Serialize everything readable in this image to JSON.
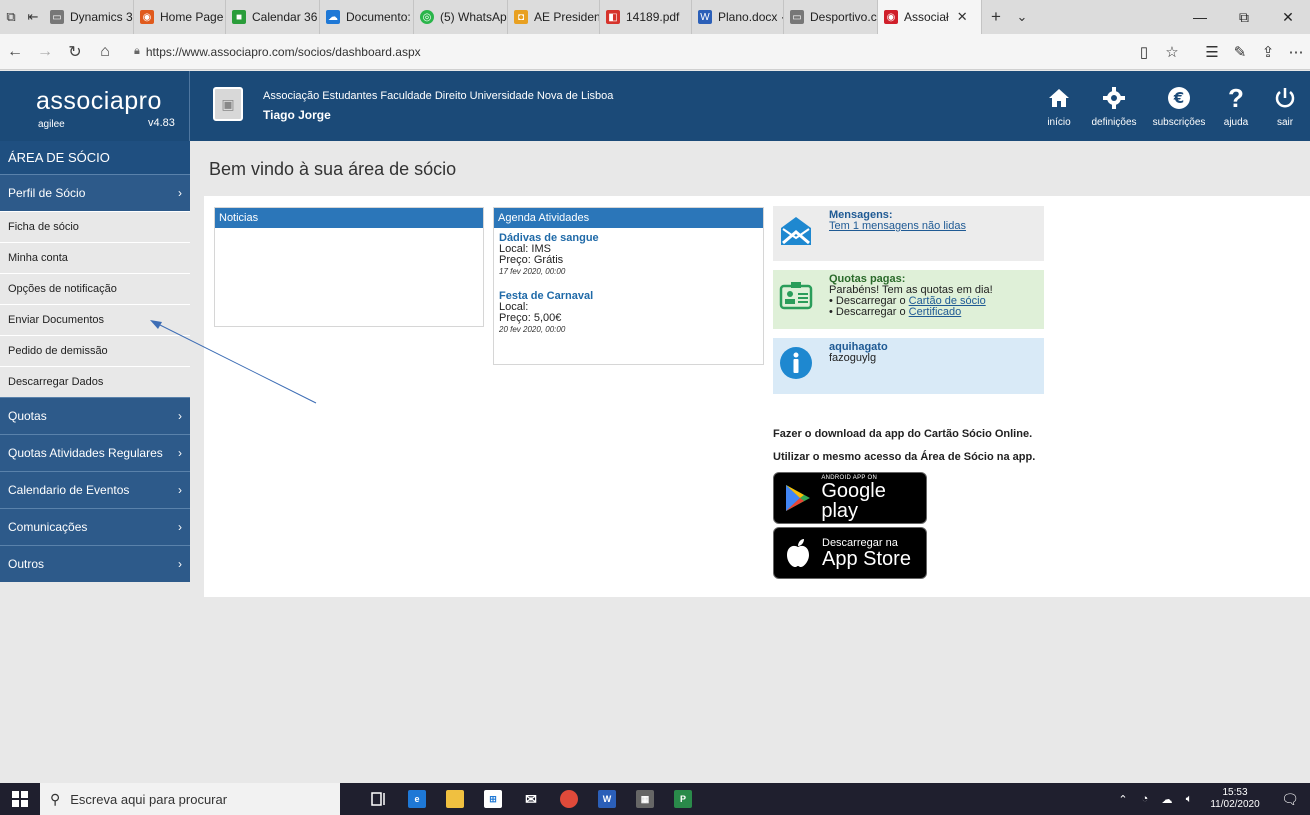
{
  "browser": {
    "tabs": [
      {
        "label": "Dynamics 3(",
        "fav_color": "#555555",
        "fav_glyph": "▭"
      },
      {
        "label": "Home Page",
        "fav_color": "#e05a1c",
        "fav_glyph": "◉"
      },
      {
        "label": "Calendar 36",
        "fav_color": "#2a9d3a",
        "fav_glyph": "■"
      },
      {
        "label": "Documento:",
        "fav_color": "#1e78d6",
        "fav_glyph": "☁"
      },
      {
        "label": "(5) WhatsAp",
        "fav_color": "#2ab54a",
        "fav_glyph": "◎"
      },
      {
        "label": "AE Presiden",
        "fav_color": "#e8a021",
        "fav_glyph": "◘"
      },
      {
        "label": "14189.pdf",
        "fav_color": "#d6332b",
        "fav_glyph": "◧"
      },
      {
        "label": "Plano.docx ·",
        "fav_color": "#2b5fb8",
        "fav_glyph": "W"
      },
      {
        "label": "Desportivo.c",
        "fav_color": "#555555",
        "fav_glyph": "▭"
      },
      {
        "label": "Associał",
        "fav_color": "#d01f2a",
        "fav_glyph": "◉",
        "active": true
      }
    ],
    "url": "https://www.associapro.com/socios/dashboard.aspx"
  },
  "header": {
    "logo": "associapro",
    "logo_sub": "agilee",
    "version": "v4.83",
    "org": "Associação Estudantes Faculdade Direito Universidade Nova de Lisboa",
    "user": "Tiago Jorge",
    "nav": [
      {
        "label": "início",
        "icon": "home-icon",
        "glyph": "⌂"
      },
      {
        "label": "definições",
        "icon": "gear-icon",
        "glyph": "⚙"
      },
      {
        "label": "subscrições",
        "icon": "euro-icon",
        "glyph": "€"
      },
      {
        "label": "ajuda",
        "icon": "help-icon",
        "glyph": "?"
      },
      {
        "label": "sair",
        "icon": "power-icon",
        "glyph": "⏻"
      }
    ]
  },
  "sidebar": {
    "title": "ÁREA DE SÓCIO",
    "profile": "Perfil de Sócio",
    "items": [
      "Ficha de sócio",
      "Minha conta",
      "Opções de notificação",
      "Enviar Documentos",
      "Pedido de demissão",
      "Descarregar Dados"
    ],
    "categories": [
      "Quotas",
      "Quotas Atividades Regulares",
      "Calendario de Eventos",
      "Comunicações",
      "Outros"
    ],
    "chevron": "›"
  },
  "main": {
    "title": "Bem vindo à sua área de sócio",
    "news_title": "Noticias",
    "agenda_title": "Agenda Atividades",
    "events": [
      {
        "title": "Dádivas de sangue",
        "local": "Local: IMS",
        "price": "Preço: Grátis",
        "date": "17 fev 2020, 00:00"
      },
      {
        "title": "Festa de Carnaval",
        "local": "Local:",
        "price": "Preço: 5,00€",
        "date": "20 fev 2020, 00:00"
      }
    ],
    "messages": {
      "title": "Mensagens:",
      "link": "Tem 1 mensagens não lidas"
    },
    "quotas": {
      "title": "Quotas pagas:",
      "text": "Parabéns! Tem as quotas em dia!",
      "line1_prefix": "• Descarregar o ",
      "line1_link": "Cartão de sócio",
      "line2_prefix": "• Descarregar o ",
      "line2_link": "Certificado"
    },
    "info": {
      "title": "aquihagato",
      "text": "fazoguylg"
    },
    "app_text1": "Fazer o download da app do Cartão Sócio Online.",
    "app_text2": "Utilizar o mesmo acesso da Área de Sócio na app.",
    "google": {
      "small": "ANDROID APP ON",
      "big": "Google play"
    },
    "apple": {
      "small": "Descarregar na",
      "big": "App Store"
    }
  },
  "taskbar": {
    "search_placeholder": "Escreva aqui para procurar",
    "time": "15:53",
    "date": "11/02/2020"
  },
  "colors": {
    "header_bg": "#1b4a78",
    "sidebar_cat": "#2d5a8a",
    "panel_head": "#2b76b9",
    "messages_bg": "#ececec",
    "quotas_bg": "#dff0d8",
    "info_bg": "#d9eaf7"
  }
}
